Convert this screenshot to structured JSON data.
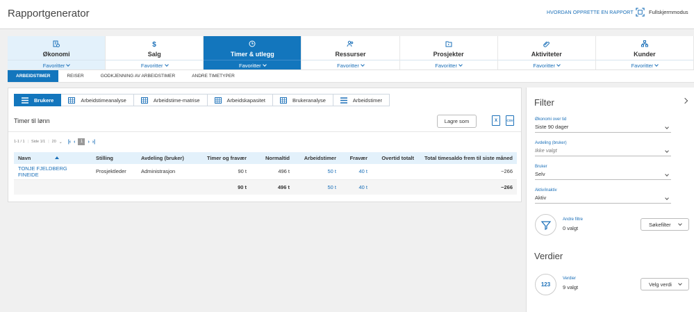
{
  "header": {
    "title": "Rapportgenerator",
    "howto": "HVORDAN OPPRETTE EN RAPPORT",
    "fullscreen": "Fullskjermmodus"
  },
  "modules": [
    {
      "label": "Økonomi",
      "fav": "Favoritter",
      "icon": "economy-icon",
      "state": "light"
    },
    {
      "label": "Salg",
      "fav": "Favoritter",
      "icon": "dollar-icon",
      "state": ""
    },
    {
      "label": "Timer & utlegg",
      "fav": "Favoritter",
      "icon": "clock-icon",
      "state": "active"
    },
    {
      "label": "Ressurser",
      "fav": "Favoritter",
      "icon": "people-icon",
      "state": ""
    },
    {
      "label": "Prosjekter",
      "fav": "Favoritter",
      "icon": "folder-icon",
      "state": ""
    },
    {
      "label": "Aktiviteter",
      "fav": "Favoritter",
      "icon": "paperclip-icon",
      "state": ""
    },
    {
      "label": "Kunder",
      "fav": "Favoritter",
      "icon": "org-icon",
      "state": ""
    }
  ],
  "subtabs": [
    "ARBEIDSTIMER",
    "REISER",
    "GODKJENNING AV ARBEIDSTIMER",
    "ANDRE TIMETYPER"
  ],
  "view_tabs": [
    {
      "label": "Brukere",
      "icon": "list-icon"
    },
    {
      "label": "Arbeidstimeanalyse",
      "icon": "grid-icon"
    },
    {
      "label": "Arbeidstime-matrise",
      "icon": "grid-icon"
    },
    {
      "label": "Arbeidskapasitet",
      "icon": "grid-icon"
    },
    {
      "label": "Brukeranalyse",
      "icon": "grid-icon"
    },
    {
      "label": "Arbeidstimer",
      "icon": "list-icon"
    }
  ],
  "report": {
    "title": "Timer til lønn",
    "save_label": "Lagre som",
    "excel_label": "X",
    "csv_label": "CSV",
    "pager": {
      "range": "1-1 / 1",
      "page": "Side 1/1",
      "per_page": "20",
      "current": "1"
    }
  },
  "table": {
    "headers": [
      "Navn",
      "Stilling",
      "Avdeling (bruker)",
      "Timer og fravær",
      "Normaltid",
      "Arbeidstimer",
      "Fravær",
      "Overtid totalt",
      "Total timesaldo frem til siste måned"
    ],
    "rows": [
      {
        "navn": "TONJE FJELDBERG FINEIDE",
        "stilling": "Prosjektleder",
        "avdeling": "Administrasjon",
        "timer": "90 t",
        "normaltid": "496 t",
        "arbeidstimer": "50 t",
        "fravaer": "40 t",
        "overtid": "",
        "saldo": "−266"
      }
    ],
    "total": {
      "timer": "90 t",
      "normaltid": "496 t",
      "arbeidstimer": "50 t",
      "fravaer": "40 t",
      "overtid": "",
      "saldo": "−266"
    }
  },
  "filter": {
    "title": "Filter",
    "fields": [
      {
        "label": "Økonomi over tid",
        "value": "Siste 90 dager"
      },
      {
        "label": "Avdeling (bruker)",
        "value": "Ikke valgt"
      },
      {
        "label": "Bruker",
        "value": "Selv"
      },
      {
        "label": "Aktiv/inaktiv",
        "value": "Aktiv"
      }
    ],
    "other_label": "Andre filtre",
    "other_value": "0 valgt",
    "search_btn": "Søkefilter"
  },
  "values": {
    "title": "Verdier",
    "badge": "123",
    "label": "Verdier",
    "value": "9 valgt",
    "btn": "Velg verdi"
  },
  "colors": {
    "accent": "#1376bd",
    "link": "#1a6fb8",
    "light": "#e3f1fb"
  }
}
